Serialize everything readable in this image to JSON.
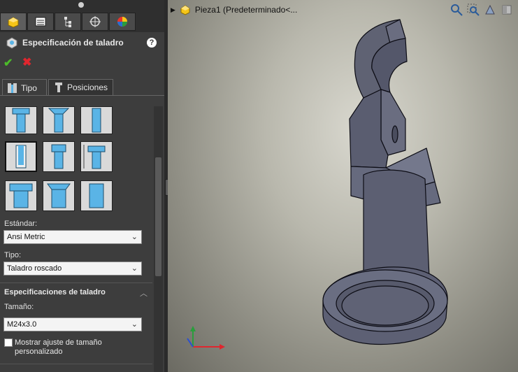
{
  "panel": {
    "title": "Especificación de taladro",
    "help": "?",
    "ok": "✔",
    "cancel": "✖",
    "tabs": [
      {
        "label": "Tipo"
      },
      {
        "label": "Posiciones"
      }
    ],
    "estandar_label": "Estándar:",
    "estandar_value": "Ansi Metric",
    "tipo_label": "Tipo:",
    "tipo_value": "Taladro roscado",
    "section_title": "Especificaciones de taladro",
    "tamano_label": "Tamaño:",
    "tamano_value": "M24x3.0",
    "checkbox_label_1": "Mostrar ajuste de tamaño",
    "checkbox_label_2": "personalizado"
  },
  "viewport": {
    "breadcrumb": "Pieza1  (Predeterminado<..."
  },
  "colors": {
    "panel_bg": "#3d3d3d",
    "part_fill": "#5f6273",
    "hole_blue": "#5ab4e6",
    "ok_green": "#4cbb2a",
    "cancel_red": "#e0262e"
  }
}
